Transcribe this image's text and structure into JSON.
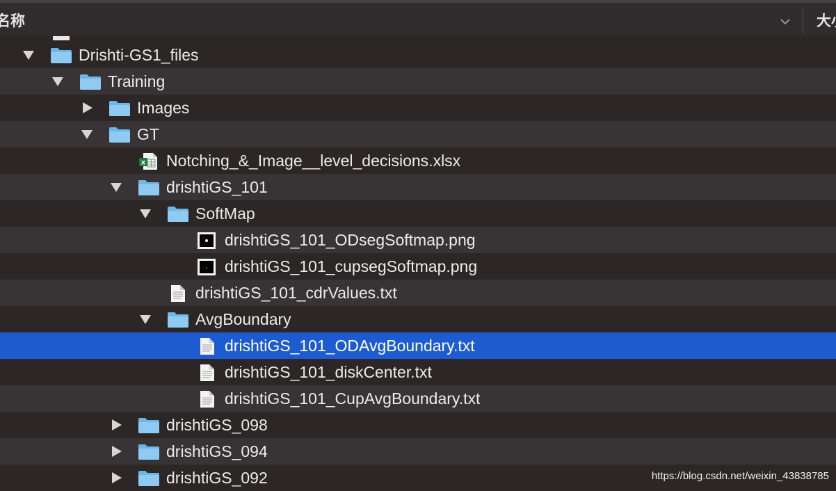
{
  "header": {
    "name_column": "名称",
    "size_column": "大小"
  },
  "rows": [
    {
      "label": "Drishti-GS1_files",
      "kind": "folder",
      "expanded": true,
      "icon": "folder-icon"
    },
    {
      "label": "Training",
      "kind": "folder",
      "expanded": true,
      "icon": "folder-icon"
    },
    {
      "label": "Images",
      "kind": "folder",
      "expanded": false,
      "icon": "folder-icon"
    },
    {
      "label": "GT",
      "kind": "folder",
      "expanded": true,
      "icon": "folder-icon"
    },
    {
      "label": "Notching_&_Image__level_decisions.xlsx",
      "kind": "file",
      "icon": "excel-file-icon"
    },
    {
      "label": "drishtiGS_101",
      "kind": "folder",
      "expanded": true,
      "icon": "folder-icon"
    },
    {
      "label": "SoftMap",
      "kind": "folder",
      "expanded": true,
      "icon": "folder-icon"
    },
    {
      "label": "drishtiGS_101_ODsegSoftmap.png",
      "kind": "file",
      "icon": "image-file-icon"
    },
    {
      "label": "drishtiGS_101_cupsegSoftmap.png",
      "kind": "file",
      "icon": "image-file-icon"
    },
    {
      "label": "drishtiGS_101_cdrValues.txt",
      "kind": "file",
      "icon": "text-file-icon"
    },
    {
      "label": "AvgBoundary",
      "kind": "folder",
      "expanded": true,
      "icon": "folder-icon"
    },
    {
      "label": "drishtiGS_101_ODAvgBoundary.txt",
      "kind": "file",
      "icon": "text-file-icon",
      "selected": true
    },
    {
      "label": "drishtiGS_101_diskCenter.txt",
      "kind": "file",
      "icon": "text-file-icon"
    },
    {
      "label": "drishtiGS_101_CupAvgBoundary.txt",
      "kind": "file",
      "icon": "text-file-icon"
    },
    {
      "label": "drishtiGS_098",
      "kind": "folder",
      "expanded": false,
      "icon": "folder-icon"
    },
    {
      "label": "drishtiGS_094",
      "kind": "folder",
      "expanded": false,
      "icon": "folder-icon"
    },
    {
      "label": "drishtiGS_092",
      "kind": "folder",
      "expanded": false,
      "icon": "folder-icon"
    }
  ],
  "watermark": "https://blog.csdn.net/weixin_43838785",
  "colors": {
    "selection": "#1d5bd1",
    "folder": "#6cb7e8",
    "background": "#2c2626",
    "row_alt": "#383334"
  }
}
